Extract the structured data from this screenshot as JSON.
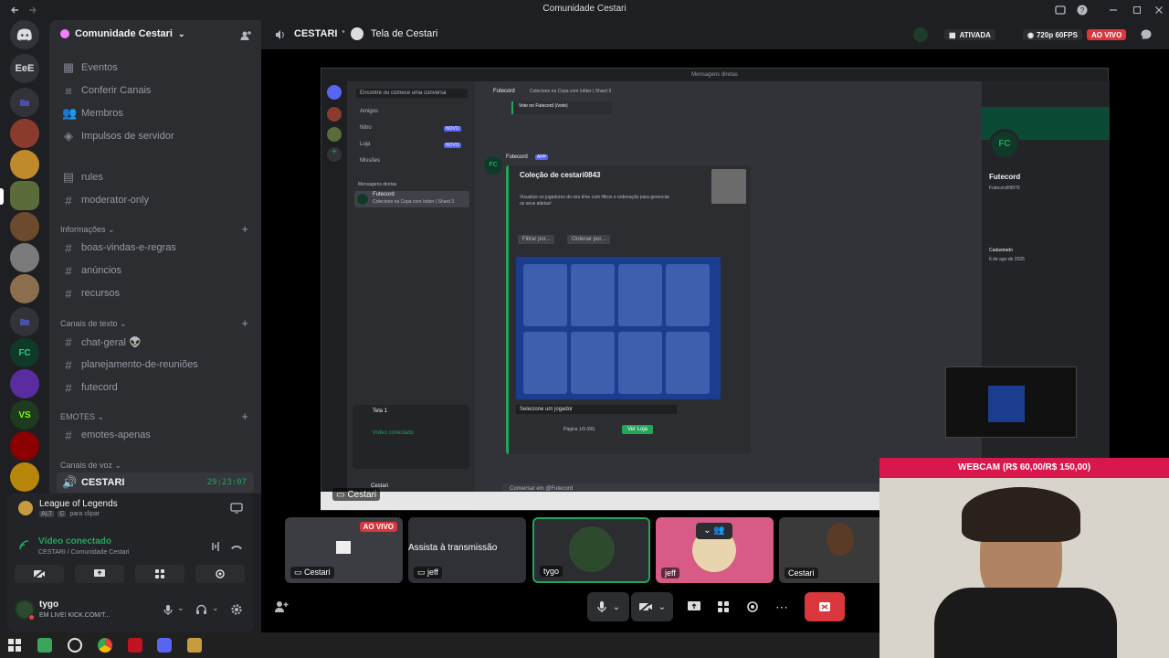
{
  "window": {
    "title": "Comunidade Cestari"
  },
  "server": {
    "name": "Comunidade Cestari"
  },
  "rail": {
    "eee_label": "EeE"
  },
  "sidebar": {
    "top_items": [
      {
        "label": "Eventos",
        "icon": "calendar-icon"
      },
      {
        "label": "Conferir Canais",
        "icon": "channels-icon"
      },
      {
        "label": "Membros",
        "icon": "members-icon"
      },
      {
        "label": "Impulsos de servidor",
        "icon": "boost-icon"
      }
    ],
    "free_channels": [
      "rules",
      "moderator-only"
    ],
    "categories": [
      {
        "name": "Informações",
        "channels": [
          "boas-vindas-e-regras",
          "anúncios",
          "recursos"
        ]
      },
      {
        "name": "Canais de texto",
        "channels": [
          "chat-geral 👽",
          "planejamento-de-reuniões",
          "futecord"
        ]
      },
      {
        "name": "EMOTES",
        "channels": [
          "emotes-apenas"
        ]
      },
      {
        "name": "Canais de voz",
        "channels": []
      }
    ],
    "voice_channel": {
      "name": "CESTARI",
      "timer": "29:23:07"
    }
  },
  "user_panel": {
    "activity_title": "League of Legends",
    "activity_shortcut_key1": "ALT",
    "activity_shortcut_key2": "C",
    "activity_shortcut_text": "para clipar",
    "video_status": "Vídeo conectado",
    "video_location": "CESTARI / Comunidade Cestari",
    "username": "tygo",
    "user_status": "EM LIVE! KICK.COM/T..."
  },
  "stage": {
    "channel_name": "CESTARI",
    "stream_title": "Tela de Cestari",
    "badge_active": "ATIVADA",
    "badge_quality": "720p 60FPS",
    "badge_live": "AO VIVO"
  },
  "shared_screen": {
    "window_title": "Mensagens diretas",
    "search_placeholder": "Encontre ou comece uma conversa",
    "dm_items": [
      "Amigos",
      "Nitro",
      "Loja",
      "Missões"
    ],
    "new_badge": "NOVO",
    "dm_header": "Mensagens diretas",
    "dm_user": "Futecord",
    "dm_user_status": "Colecione na Copa com /obter | Shard 3",
    "chat_header": "Futecord",
    "chat_topic": "Colecione na Copa com /obter | Shard 3",
    "vote_text": "Vote no Futecord (/vote)",
    "bot_name": "Futecord",
    "app_badge": "APP",
    "embed_title": "Coleção de cestari0843",
    "embed_text": "Visualize os jogadores do seu time com filtros e ordenação para gerenciar os seus atletas!",
    "filter_btn": "Filtrar por...",
    "order_btn": "Ordenar por...",
    "select_placeholder": "Selecione um jogador",
    "page_text": "Página 1/9 (80)",
    "ver_loja": "Ver Loja",
    "input_placeholder": "Conversar em @Futecord",
    "screen_label": "Tela 1",
    "inner_video_status": "Vídeo conectado",
    "inner_user": "Cestari",
    "profile_name": "Futecord",
    "profile_tag": "Futecord#9976",
    "profile_join_label": "Cadastrado",
    "profile_join_date": "6 de ago de 2025"
  },
  "tiles": [
    {
      "label": "Cestari",
      "badge": "AO VIVO"
    },
    {
      "label": "jeff",
      "overlay": "Assista à transmissão"
    },
    {
      "label": "tygo"
    },
    {
      "label": "jeff"
    },
    {
      "label": "Cestari"
    }
  ],
  "pip_label": "Cestari",
  "webcam": {
    "banner": "WEBCAM (R$ 60,00/R$ 150,00)"
  },
  "colors": {
    "accent_green": "#23a55a",
    "live_red": "#da373c",
    "webcam_pink": "#d8184d",
    "sidebar_bg": "#2b2d31",
    "rail_bg": "#1e1f22"
  }
}
